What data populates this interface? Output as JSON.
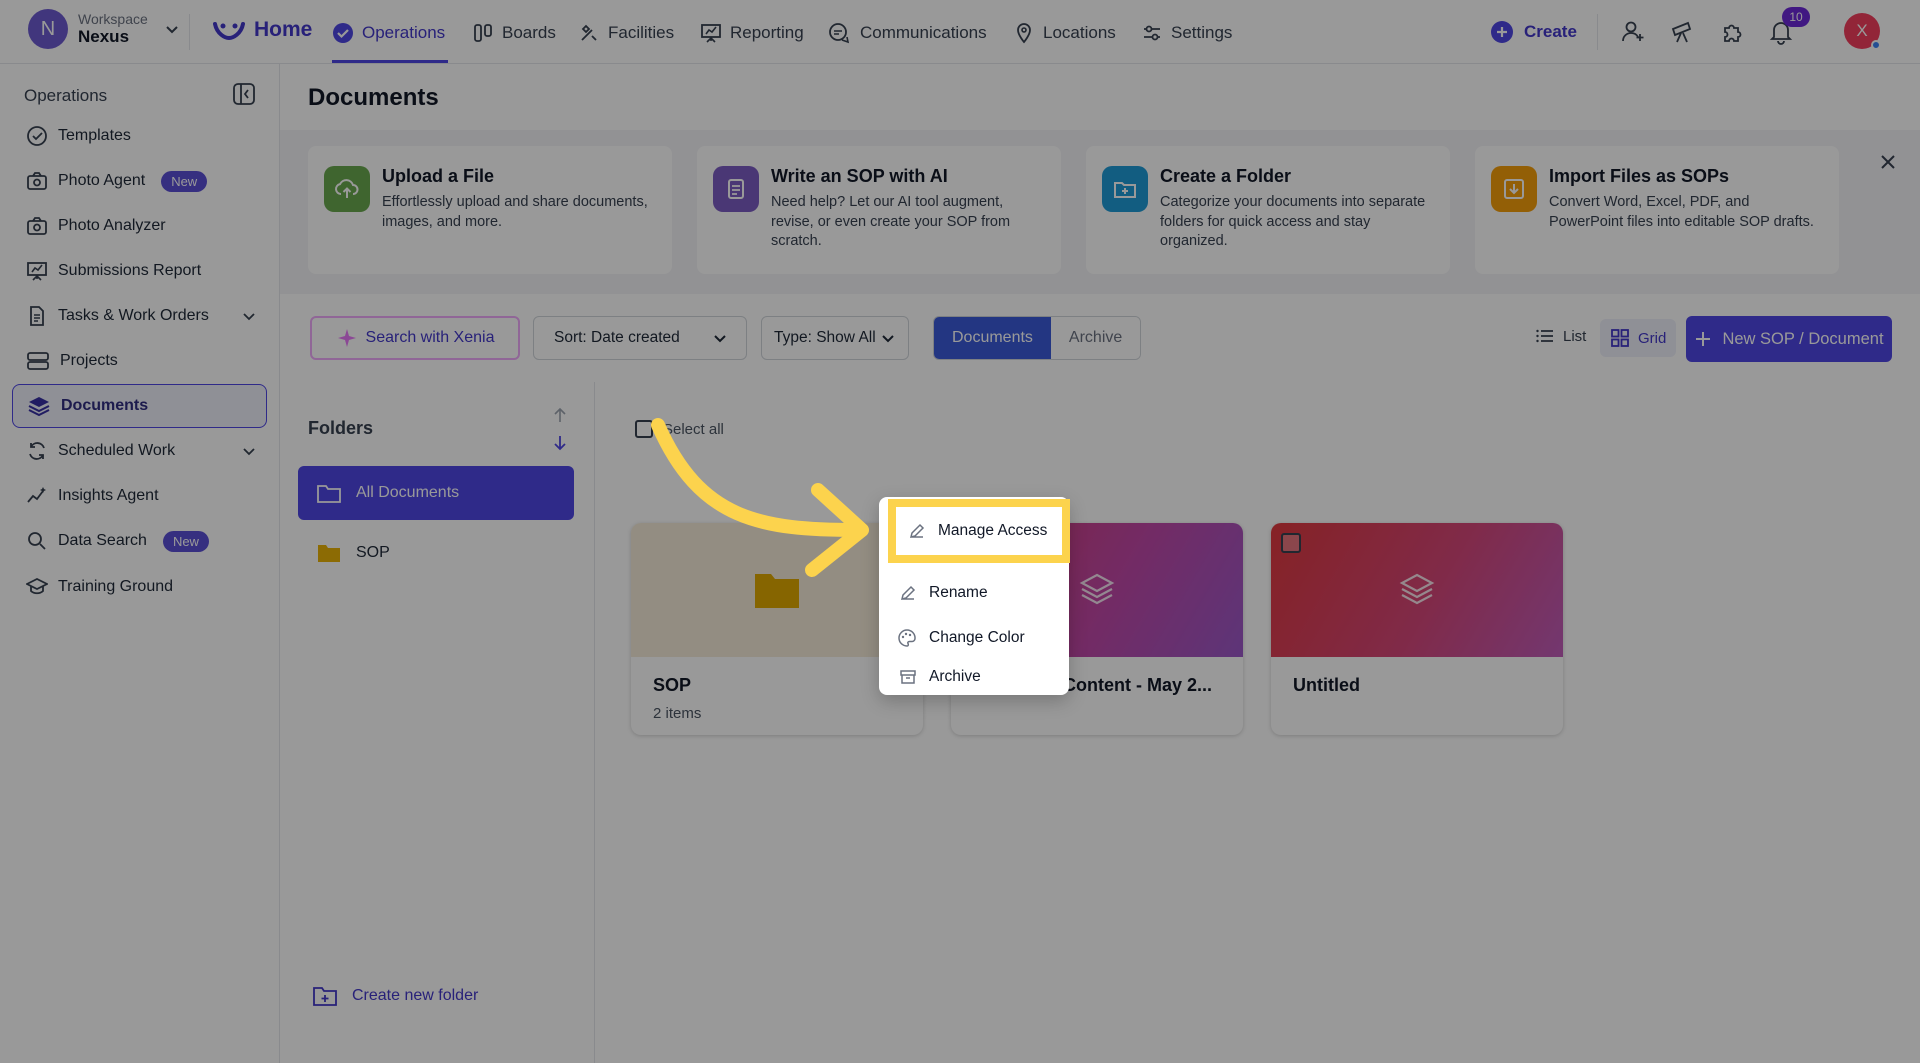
{
  "workspace": {
    "caption": "Workspace",
    "name": "Nexus",
    "initial": "N"
  },
  "topnav": {
    "home": "Home",
    "items": [
      "Operations",
      "Boards",
      "Facilities",
      "Reporting",
      "Communications",
      "Locations",
      "Settings"
    ],
    "create": "Create",
    "notifications_count": "10",
    "user_initial": "X"
  },
  "sidebar": {
    "title": "Operations",
    "items": [
      {
        "label": "Templates",
        "icon": "check-circle-icon"
      },
      {
        "label": "Photo Agent",
        "icon": "camera-icon",
        "badge": "New"
      },
      {
        "label": "Photo Analyzer",
        "icon": "camera-icon"
      },
      {
        "label": "Submissions Report",
        "icon": "report-icon"
      },
      {
        "label": "Tasks & Work Orders",
        "icon": "clipboard-icon",
        "expandable": true
      },
      {
        "label": "Projects",
        "icon": "projects-icon"
      },
      {
        "label": "Documents",
        "icon": "layers-icon",
        "active": true
      },
      {
        "label": "Scheduled Work",
        "icon": "refresh-icon",
        "expandable": true
      },
      {
        "label": "Insights Agent",
        "icon": "insights-icon"
      },
      {
        "label": "Data Search",
        "icon": "search-icon",
        "badge": "New"
      },
      {
        "label": "Training Ground",
        "icon": "graduation-icon"
      }
    ]
  },
  "page": {
    "title": "Documents"
  },
  "quick_actions": [
    {
      "title": "Upload a File",
      "desc": "Effortlessly upload and share documents, images, and more.",
      "color": "#6aa84f"
    },
    {
      "title": "Write an SOP with AI",
      "desc": "Need help? Let our AI tool augment, revise, or even create your SOP from scratch.",
      "color": "#7c5cc4"
    },
    {
      "title": "Create a Folder",
      "desc": "Categorize your documents into separate folders for quick access and stay organized.",
      "color": "#1e9bd7"
    },
    {
      "title": "Import Files as SOPs",
      "desc": "Convert Word, Excel, PDF, and PowerPoint files into editable SOP drafts.",
      "color": "#f59e0b"
    }
  ],
  "toolbar": {
    "search_xenia": "Search with Xenia",
    "sort": "Sort: Date created",
    "type": "Type: Show All",
    "seg_documents": "Documents",
    "seg_archive": "Archive",
    "view_list": "List",
    "view_grid": "Grid",
    "new_doc": "New SOP / Document"
  },
  "folders": {
    "title": "Folders",
    "items": [
      "All Documents",
      "SOP"
    ],
    "create": "Create new folder"
  },
  "grid": {
    "select_all": "Select all",
    "cards": [
      {
        "name": "SOP",
        "sub": "2 items",
        "type": "folder"
      },
      {
        "name": "Content - May 2...",
        "sub": "",
        "type": "document"
      },
      {
        "name": "Untitled",
        "sub": "",
        "type": "document"
      }
    ]
  },
  "context_menu": {
    "items": [
      "Manage Access",
      "Rename",
      "Change Color",
      "Archive"
    ],
    "highlighted": "Manage Access"
  },
  "colors": {
    "accent": "#4f46e5",
    "highlight": "#fcd34d"
  }
}
